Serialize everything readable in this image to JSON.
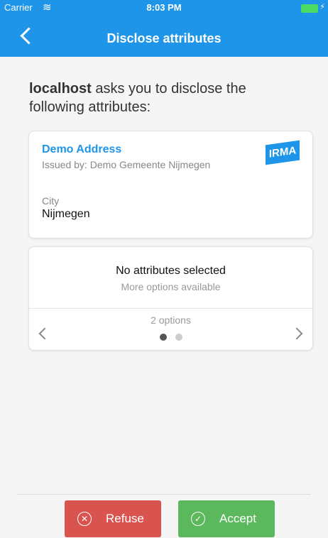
{
  "status_bar": {
    "carrier": "Carrier",
    "time": "8:03 PM"
  },
  "nav": {
    "title": "Disclose attributes",
    "back_icon": "chevron-left-icon"
  },
  "intro": {
    "requester": "localhost",
    "text": " asks you to disclose the following attributes:"
  },
  "credential": {
    "title": "Demo Address",
    "issuer": "Issued by: Demo Gemeente Nijmegen",
    "logo_text": "IRMA",
    "attribute_label": "City",
    "attribute_value": "Nijmegen"
  },
  "selection": {
    "title": "No attributes selected",
    "subtitle": "More options available",
    "options_label": "2 options",
    "pages": 2,
    "current_page": 1
  },
  "buttons": {
    "refuse": "Refuse",
    "accept": "Accept"
  },
  "colors": {
    "primary": "#1e95e8",
    "refuse": "#d9534f",
    "accept": "#5cb85c"
  }
}
